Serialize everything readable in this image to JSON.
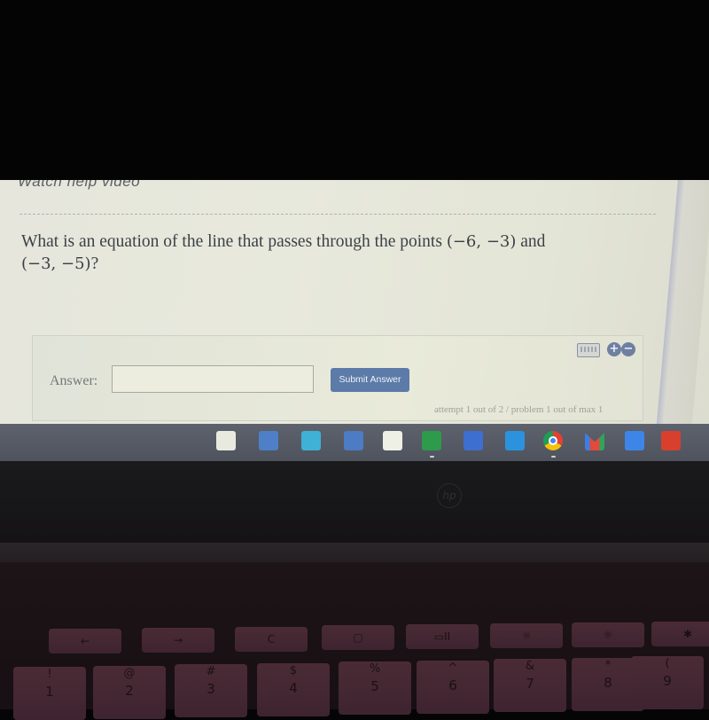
{
  "page": {
    "help_link": "Watch help video",
    "question_text": "What is an equation of the line that passes through the points",
    "point1": "(−6, −3)",
    "conjunction": "and",
    "point2": "(−3, −5)",
    "question_end": "?"
  },
  "answer": {
    "label": "Answer:",
    "value": "",
    "placeholder": "",
    "submit_label": "Submit Answer",
    "plus_symbol": "+",
    "minus_symbol": "−"
  },
  "status": {
    "attempt_text": "attempt 1 out of 2 / problem 1 out of max 1"
  },
  "colors": {
    "submit_button": "#5c7ba8",
    "screen_background": "#e6e7db",
    "taskbar": "#575b66"
  },
  "taskbar": {
    "apps": [
      {
        "name": "app-launcher-icon",
        "color": "#e9eadf",
        "active": false
      },
      {
        "name": "calculator-icon",
        "color": "#4f7fc6",
        "active": false
      },
      {
        "name": "blue-tools-app-icon",
        "color": "#3fb0d6",
        "active": false
      },
      {
        "name": "game-app-icon",
        "color": "#4d7bc4",
        "active": false
      },
      {
        "name": "twitter-web-app-icon",
        "color": "#eef0e6",
        "active": false
      },
      {
        "name": "google-classroom-icon",
        "color": "#2e9a4c",
        "active": true
      },
      {
        "name": "texas-flag-app-icon",
        "color": "#3d6fd1",
        "active": false
      },
      {
        "name": "cloud-chat-app-icon",
        "color": "#2c92de",
        "active": false
      },
      {
        "name": "chrome-icon",
        "color": "#e34133",
        "active": true
      },
      {
        "name": "gmail-icon",
        "color": "#e04a3f",
        "active": false
      },
      {
        "name": "google-docs-icon",
        "color": "#3d86e8",
        "active": false
      },
      {
        "name": "youtube-icon",
        "color": "#d8402d",
        "active": false
      }
    ]
  },
  "laptop": {
    "brand": "hp"
  },
  "keyboard": {
    "row1": [
      "←",
      "→",
      "C",
      "▢",
      "▭II",
      "☼",
      "☼",
      "✱"
    ],
    "row2": [
      {
        "top": "!",
        "bottom": "1"
      },
      {
        "top": "@",
        "bottom": "2"
      },
      {
        "top": "#",
        "bottom": "3"
      },
      {
        "top": "$",
        "bottom": "4"
      },
      {
        "top": "%",
        "bottom": "5"
      },
      {
        "top": "^",
        "bottom": "6"
      },
      {
        "top": "&",
        "bottom": "7"
      },
      {
        "top": "*",
        "bottom": "8"
      },
      {
        "top": "(",
        "bottom": "9"
      }
    ]
  }
}
